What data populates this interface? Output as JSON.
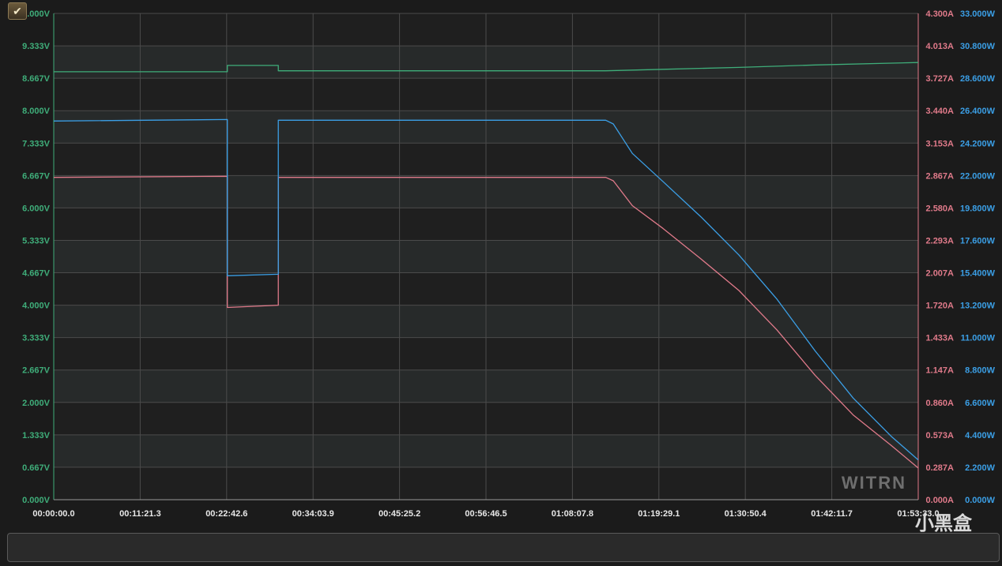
{
  "watermark_label": "小黑盒",
  "menu_glyph": "✔",
  "colors": {
    "voltage": "#3fae7a",
    "current": "#e07a8a",
    "power": "#3b9fe6",
    "xtick": "#e8e8e8",
    "grid": "#4b4b4b"
  },
  "chart_data": {
    "type": "line",
    "brand_logo": "WITRN",
    "x_axis": {
      "ticks": [
        "00:00:00.0",
        "00:11:21.3",
        "00:22:42.6",
        "00:34:03.9",
        "00:45:25.2",
        "00:56:46.5",
        "01:08:07.8",
        "01:19:29.1",
        "01:30:50.4",
        "01:42:11.7",
        "01:53:33.0"
      ],
      "range_minutes": [
        0,
        113.55
      ]
    },
    "y_left": {
      "ticks": [
        "0.000V",
        "0.667V",
        "1.333V",
        "2.000V",
        "2.667V",
        "3.333V",
        "4.000V",
        "4.667V",
        "5.333V",
        "6.000V",
        "6.667V",
        "7.333V",
        "8.000V",
        "8.667V",
        "9.333V",
        "10.000V"
      ],
      "range": [
        0,
        10
      ]
    },
    "y_right_current": {
      "ticks": [
        "0.000A",
        "0.287A",
        "0.573A",
        "0.860A",
        "1.147A",
        "1.433A",
        "1.720A",
        "2.007A",
        "2.293A",
        "2.580A",
        "2.867A",
        "3.153A",
        "3.440A",
        "3.727A",
        "4.013A",
        "4.300A"
      ],
      "range": [
        0,
        4.3
      ]
    },
    "y_right_power": {
      "ticks": [
        "0.000W",
        "2.200W",
        "4.400W",
        "6.600W",
        "8.800W",
        "11.000W",
        "13.200W",
        "15.400W",
        "17.600W",
        "19.800W",
        "22.000W",
        "24.200W",
        "26.400W",
        "28.600W",
        "30.800W",
        "33.000W"
      ],
      "range": [
        0,
        33
      ]
    },
    "grid": true,
    "series": [
      {
        "key": "voltage",
        "axis": "voltage",
        "x": [
          0,
          22.8,
          22.8,
          29.5,
          29.5,
          72.5,
          80,
          90,
          100,
          113.55
        ],
        "values": [
          8.8,
          8.8,
          8.93,
          8.93,
          8.82,
          8.82,
          8.85,
          8.89,
          8.94,
          8.99
        ]
      },
      {
        "key": "current",
        "axis": "current",
        "x": [
          0,
          22.8,
          22.8,
          29.5,
          29.5,
          72.5,
          73.5,
          76,
          80,
          85,
          90,
          95,
          100,
          105,
          110,
          113.55
        ],
        "values": [
          2.85,
          2.86,
          1.7,
          1.72,
          2.85,
          2.85,
          2.82,
          2.6,
          2.4,
          2.13,
          1.85,
          1.5,
          1.1,
          0.75,
          0.48,
          0.28
        ]
      },
      {
        "key": "power",
        "axis": "power",
        "x": [
          0,
          22.8,
          22.8,
          29.5,
          29.5,
          72.5,
          73.5,
          76,
          80,
          85,
          90,
          95,
          100,
          105,
          110,
          113.55
        ],
        "values": [
          25.7,
          25.8,
          15.2,
          15.3,
          25.75,
          25.75,
          25.5,
          23.5,
          21.6,
          19.2,
          16.6,
          13.6,
          10.1,
          6.9,
          4.3,
          2.7
        ]
      }
    ]
  }
}
